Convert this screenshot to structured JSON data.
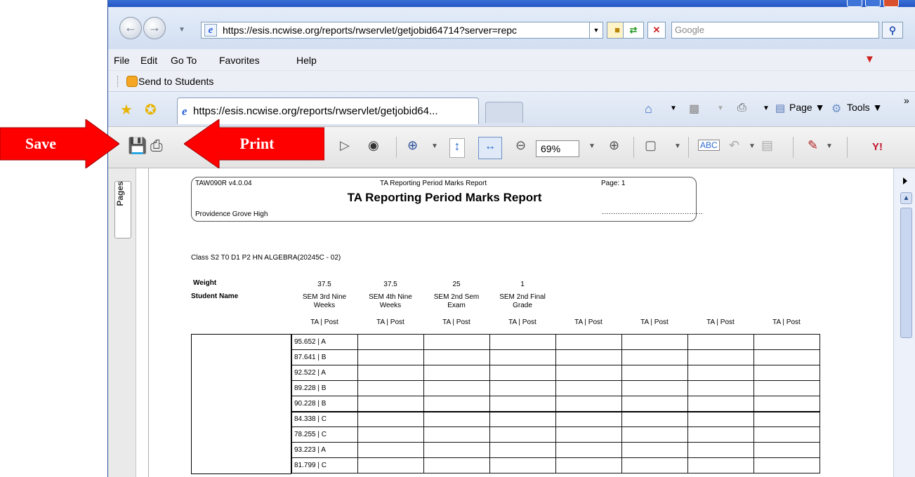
{
  "browser": {
    "url": "https://esis.ncwise.org/reports/rwservlet/getjobid64714?server=repc",
    "search_placeholder": "Google",
    "menu": [
      "File",
      "Edit",
      "Go To",
      "Favorites",
      "Help"
    ],
    "links_bar": {
      "item": "Send to Students"
    },
    "tab_title": "https://esis.ncwise.org/reports/rwservlet/getjobid64...",
    "commands": {
      "page": "Page",
      "tools": "Tools"
    }
  },
  "pdf_toolbar": {
    "zoom": "69%"
  },
  "side_pane": {
    "pages_tab": "Pages"
  },
  "annotations": {
    "save": "Save",
    "print": "Print",
    "color": "#ff0000"
  },
  "report": {
    "code": "TAW090R v4.0.04",
    "small_title": "TA Reporting Period Marks Report",
    "page_label": "Page:  1",
    "title": "TA Reporting Period Marks Report",
    "school": "Providence Grove High",
    "class_line": "Class   S2 T0 D1 P2 HN ALGEBRA(20245C - 02)",
    "weight_label": "Weight",
    "student_name_label": "Student Name",
    "columns": [
      {
        "weight": "37.5",
        "name": "SEM 3rd Nine Weeks",
        "sub": "TA | Post"
      },
      {
        "weight": "37.5",
        "name": "SEM 4th Nine Weeks",
        "sub": "TA | Post"
      },
      {
        "weight": "25",
        "name": "SEM 2nd Sem Exam",
        "sub": "TA | Post"
      },
      {
        "weight": "1",
        "name": "SEM 2nd Final Grade",
        "sub": "TA | Post"
      },
      {
        "weight": "",
        "name": "",
        "sub": "TA | Post"
      },
      {
        "weight": "",
        "name": "",
        "sub": "TA | Post"
      },
      {
        "weight": "",
        "name": "",
        "sub": "TA | Post"
      },
      {
        "weight": "",
        "name": "",
        "sub": "TA | Post"
      }
    ],
    "marks": [
      "95.652 | A",
      "87.641 | B",
      "92.522 | A",
      "89.228 | B",
      "90.228 | B",
      "84.338 | C",
      "78.255 | C",
      "93.223 | A",
      "81.799 | C"
    ]
  }
}
